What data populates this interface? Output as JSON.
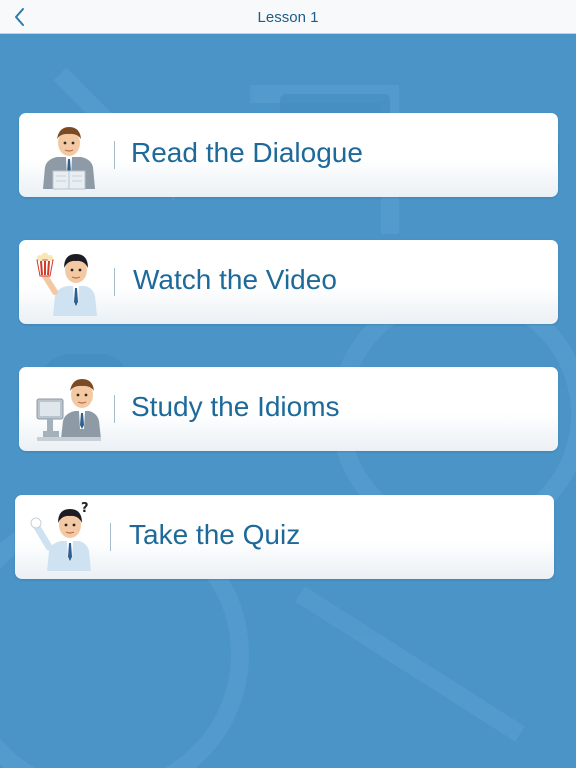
{
  "header": {
    "title": "Lesson 1",
    "back_icon": "chevron-left-icon"
  },
  "menu": [
    {
      "label": "Read the Dialogue",
      "icon": "man-reading-icon"
    },
    {
      "label": "Watch the Video",
      "icon": "man-with-popcorn-icon"
    },
    {
      "label": "Study the Idioms",
      "icon": "man-at-computer-icon"
    },
    {
      "label": "Take the Quiz",
      "icon": "man-with-question-icon"
    }
  ],
  "colors": {
    "accent": "#1d6a9a",
    "background": "#4a94c8",
    "card": "#ffffff"
  }
}
